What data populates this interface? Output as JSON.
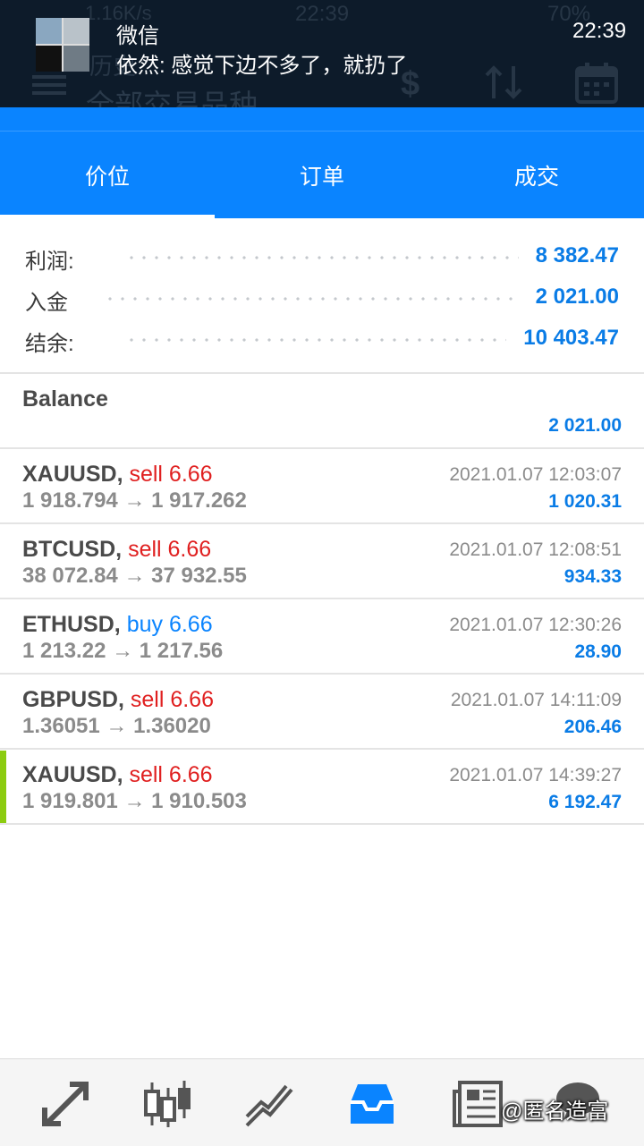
{
  "notification": {
    "app": "微信",
    "message": "依然: 感觉下边不多了，就扔了",
    "time": "22:39"
  },
  "statusbar": {
    "speed": "1.16K/s",
    "time": "22:39",
    "battery": "70%"
  },
  "toolbar": {
    "title_hint": "历史",
    "subtitle": "全部交易品种"
  },
  "tabs": [
    {
      "label": "价位",
      "active": true
    },
    {
      "label": "订单",
      "active": false
    },
    {
      "label": "成交",
      "active": false
    }
  ],
  "summary": [
    {
      "label": "利润:",
      "value": "8 382.47"
    },
    {
      "label": "入金",
      "value": "2 021.00"
    },
    {
      "label": "结余:",
      "value": "10 403.47"
    }
  ],
  "balance": {
    "label": "Balance",
    "amount": "2 021.00"
  },
  "deals": [
    {
      "symbol": "XAUUSD,",
      "side": "sell 6.66",
      "type": "sell",
      "prices": "1 918.794 → 1 917.262",
      "time": "2021.01.07 12:03:07",
      "profit": "1 020.31"
    },
    {
      "symbol": "BTCUSD,",
      "side": "sell 6.66",
      "type": "sell",
      "prices": "38 072.84 → 37 932.55",
      "time": "2021.01.07 12:08:51",
      "profit": "934.33"
    },
    {
      "symbol": "ETHUSD,",
      "side": "buy 6.66",
      "type": "buy",
      "prices": "1 213.22 → 1 217.56",
      "time": "2021.01.07 12:30:26",
      "profit": "28.90"
    },
    {
      "symbol": "GBPUSD,",
      "side": "sell 6.66",
      "type": "sell",
      "prices": "1.36051 → 1.36020",
      "time": "2021.01.07 14:11:09",
      "profit": "206.46"
    },
    {
      "symbol": "XAUUSD,",
      "side": "sell 6.66",
      "type": "sell",
      "prices": "1 919.801 → 1 910.503",
      "time": "2021.01.07 14:39:27",
      "profit": "6 192.47"
    }
  ],
  "bottom_nav": [
    {
      "icon": "quotes-arrows-icon",
      "active": false
    },
    {
      "icon": "chart-candles-icon",
      "active": false
    },
    {
      "icon": "trend-lines-icon",
      "active": false
    },
    {
      "icon": "history-inbox-icon",
      "active": true
    },
    {
      "icon": "news-icon",
      "active": false
    }
  ],
  "watermark": "@匿名造富",
  "colors": {
    "accent": "#0a84ff",
    "sell": "#e02020",
    "buy": "#0a84ff",
    "marker": "#8ccc10",
    "topbar": "#0d1b2a"
  }
}
